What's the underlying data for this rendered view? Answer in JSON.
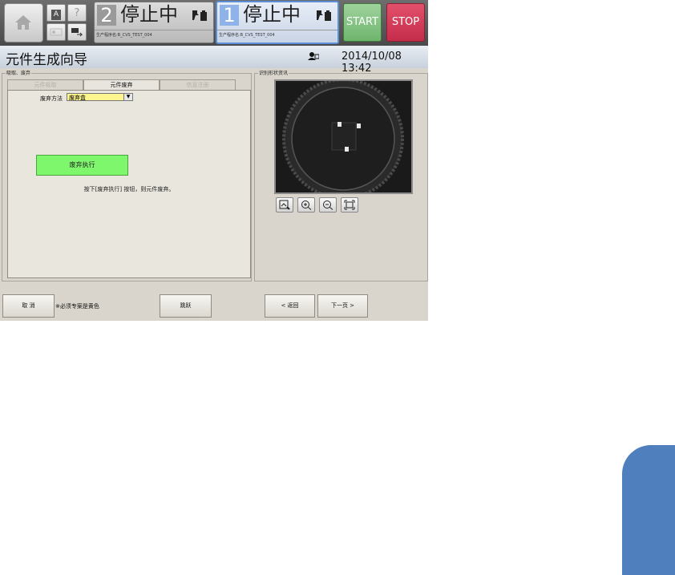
{
  "topbar": {
    "small_buttons": [
      "A",
      "?"
    ],
    "lines": [
      {
        "number": "2",
        "status": "停止中",
        "program": "生产程序名:B_CVS_TEST_004"
      },
      {
        "number": "1",
        "status": "停止中",
        "program": "生产程序名:B_CVS_TEST_004"
      }
    ],
    "start_label": "START",
    "stop_label": "STOP",
    "colors": {
      "start": "#7fc47d",
      "stop": "#d23a57",
      "active_line": "#5b8ed6"
    }
  },
  "titlebar": {
    "title": "元件生成向导",
    "datetime": "2014/10/08 13:42"
  },
  "left_panel": {
    "caption": "吸取、废弃",
    "tabs": [
      {
        "label": "元件吸取",
        "state": "disabled"
      },
      {
        "label": "元件废弃",
        "state": "active"
      },
      {
        "label": "信息注册",
        "state": "disabled"
      }
    ],
    "method_label": "废弃方法",
    "method_value": "废弃盒",
    "exec_label": "废弃执行",
    "exec_color": "#7ff76c",
    "hint": "按下[废弃执行] 按钮，则元件废弃。"
  },
  "right_panel": {
    "caption": "识别形状资讯",
    "camera_buttons": [
      "image-load-icon",
      "zoom-in-icon",
      "zoom-out-icon",
      "fit-icon"
    ]
  },
  "bottom": {
    "cancel_label": "取 消",
    "note": "※必须专案是黄色",
    "skip_label": "跳跃",
    "back_label": "< 返回",
    "next_label": "下一页 >"
  },
  "side_tab_color": "#4f80bd"
}
